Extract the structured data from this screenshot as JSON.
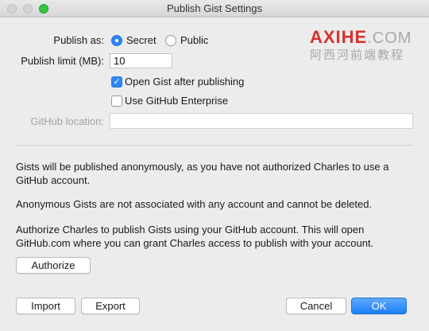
{
  "window": {
    "title": "Publish Gist Settings"
  },
  "publish_as": {
    "label": "Publish as:",
    "options": [
      {
        "label": "Secret",
        "selected": true
      },
      {
        "label": "Public",
        "selected": false
      }
    ]
  },
  "publish_limit": {
    "label": "Publish limit (MB):",
    "value": "10"
  },
  "options": {
    "open_gist": {
      "label": "Open Gist after publishing",
      "checked": true
    },
    "use_enterprise": {
      "label": "Use GitHub Enterprise",
      "checked": false
    }
  },
  "github_location": {
    "label": "GitHub location:",
    "value": ""
  },
  "messages": {
    "anonymous": "Gists will be published anonymously, as you have not authorized Charles to use a GitHub account.",
    "not_associated": "Anonymous Gists are not associated with any account and cannot be deleted.",
    "authorize_info": "Authorize Charles to publish Gists using your GitHub account. This will open GitHub.com where you can grant Charles access to publish with your account."
  },
  "buttons": {
    "authorize": "Authorize",
    "import": "Import",
    "export": "Export",
    "cancel": "Cancel",
    "ok": "OK"
  },
  "watermark": {
    "logo": "AXIHE",
    "domain": ".COM",
    "subtitle": "阿西河前端教程"
  },
  "colors": {
    "accent": "#2f86f6",
    "watermark_red": "#d9312b",
    "close_inactive": "#d4d4d4",
    "maximize": "#2fc840"
  }
}
